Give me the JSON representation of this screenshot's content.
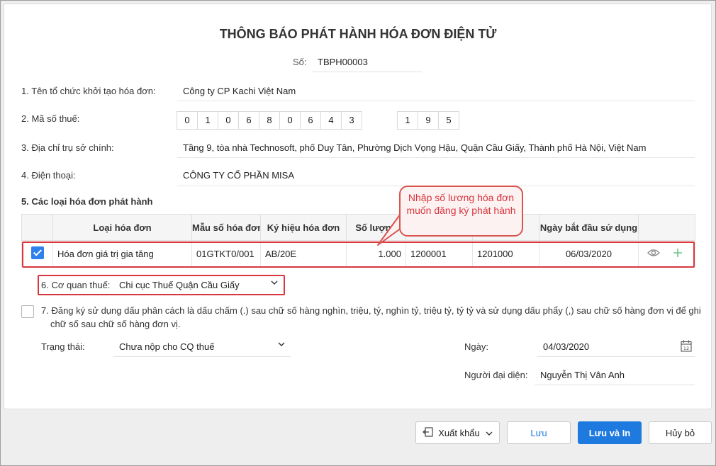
{
  "title": "THÔNG BÁO PHÁT HÀNH HÓA ĐƠN ĐIỆN TỬ",
  "so": {
    "label": "Số:",
    "value": "TBPH00003"
  },
  "fields": {
    "org_label": "1. Tên tổ chức khởi tạo hóa đơn:",
    "org_value": "Công ty CP Kachi Việt Nam",
    "tax_label": "2. Mã số thuế:",
    "tax_digits": [
      "0",
      "1",
      "0",
      "6",
      "8",
      "0",
      "6",
      "4",
      "3"
    ],
    "tax_suffix": [
      "1",
      "9",
      "5"
    ],
    "addr_label": "3. Địa chỉ trụ sở chính:",
    "addr_value": "Tầng 9, tòa nhà Technosoft, phố Duy Tân, Phường Dịch Vọng Hậu, Quận Cầu Giấy, Thành phố Hà Nội, Việt Nam",
    "phone_label": "4. Điện thoại:",
    "phone_value": "CÔNG TY CỔ PHẦN MISA"
  },
  "section5": {
    "title": "5. Các loại hóa đơn phát hành",
    "columns": [
      "Loại hóa đơn",
      "Mẫu số hóa đơn",
      "Ký hiệu hóa đơn",
      "Số lượng",
      "",
      "",
      "Ngày bắt đầu sử dụng",
      ""
    ],
    "row": {
      "checked": true,
      "type": "Hóa đơn giá trị gia tăng",
      "template": "01GTKT0/001",
      "symbol": "AB/20E",
      "quantity": "1.000",
      "from": "1200001",
      "to": "1201000",
      "start_date": "06/03/2020"
    }
  },
  "callout": "Nhập số lương hóa đơn muốn đăng ký phát hành",
  "tax_office": {
    "label": "6. Cơ quan thuế:",
    "value": "Chi cục Thuế Quận Cầu Giấy"
  },
  "section7": {
    "checked": false,
    "text_line1": "7. Đăng ký sử dụng dấu phân cách là dấu chấm (.) sau chữ số hàng nghìn, triệu, tỷ, nghìn tỷ, triệu tỷ, tỷ tỷ và sử dụng dấu phẩy (,) sau chữ số hàng đơn vị để ghi",
    "text_line2": "chữ số sau chữ số hàng đơn vị."
  },
  "status": {
    "label": "Trạng thái:",
    "value": "Chưa nộp cho CQ thuế"
  },
  "date": {
    "label": "Ngày:",
    "value": "04/03/2020",
    "calendar_day": "12"
  },
  "representative": {
    "label": "Người đại diện:",
    "value": "Nguyễn Thị Vân Anh"
  },
  "buttons": {
    "export": "Xuất khẩu",
    "save": "Lưu",
    "save_print": "Lưu và In",
    "cancel": "Hủy bỏ"
  },
  "colors": {
    "primary": "#1f7ae0",
    "highlight": "#d9363e",
    "checkbox": "#2f80ed"
  }
}
